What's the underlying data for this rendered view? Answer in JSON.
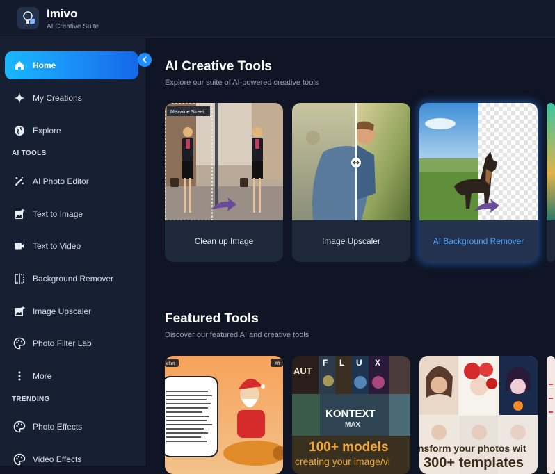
{
  "app": {
    "name": "Imivo",
    "subtitle": "AI Creative Suite"
  },
  "sidebar": {
    "nav": [
      {
        "label": "Home",
        "icon": "home-icon",
        "active": true
      },
      {
        "label": "My Creations",
        "icon": "sparkle-icon"
      },
      {
        "label": "Explore",
        "icon": "globe-icon"
      }
    ],
    "ai_tools_label": "AI TOOLS",
    "ai_tools": [
      {
        "label": "AI Photo Editor",
        "icon": "magic-wand-icon"
      },
      {
        "label": "Text to Image",
        "icon": "image-plus-icon"
      },
      {
        "label": "Text to Video",
        "icon": "video-icon"
      },
      {
        "label": "Background Remover",
        "icon": "split-frame-icon"
      },
      {
        "label": "Image Upscaler",
        "icon": "image-plus-icon"
      },
      {
        "label": "Photo Filter Lab",
        "icon": "palette-icon"
      },
      {
        "label": "More",
        "icon": "more-vertical-icon"
      }
    ],
    "trending_label": "TRENDING",
    "trending": [
      {
        "label": "Photo Effects",
        "icon": "palette-icon"
      },
      {
        "label": "Video Effects",
        "icon": "palette-icon"
      }
    ]
  },
  "main": {
    "ai_tools": {
      "title": "AI Creative Tools",
      "subtitle": "Explore our suite of AI-powered creative tools",
      "cards": [
        {
          "label": "Clean up Image",
          "street_sign": "Mezwine Street"
        },
        {
          "label": "Image Upscaler"
        },
        {
          "label": "AI Background Remover",
          "selected": true
        }
      ]
    },
    "featured": {
      "title": "Featured Tools",
      "subtitle": "Discover our featured AI and creative tools",
      "cards": [
        {
          "tag_left": "efort",
          "tag_right": "Aft"
        },
        {
          "flux_letters": [
            "F",
            "L",
            "U",
            "X"
          ],
          "brand": "KONTEXT",
          "brand_sub": "MAX",
          "headline": "100+ models",
          "caption": "creating your image/vi",
          "corner": "AUT"
        },
        {
          "headline": "nsform your photos wit",
          "headline2": "300+ templates"
        }
      ]
    }
  },
  "colors": {
    "accent": "#1a8cf5",
    "background": "#0f1524",
    "sidebar": "#172033",
    "card": "#1e283b"
  }
}
